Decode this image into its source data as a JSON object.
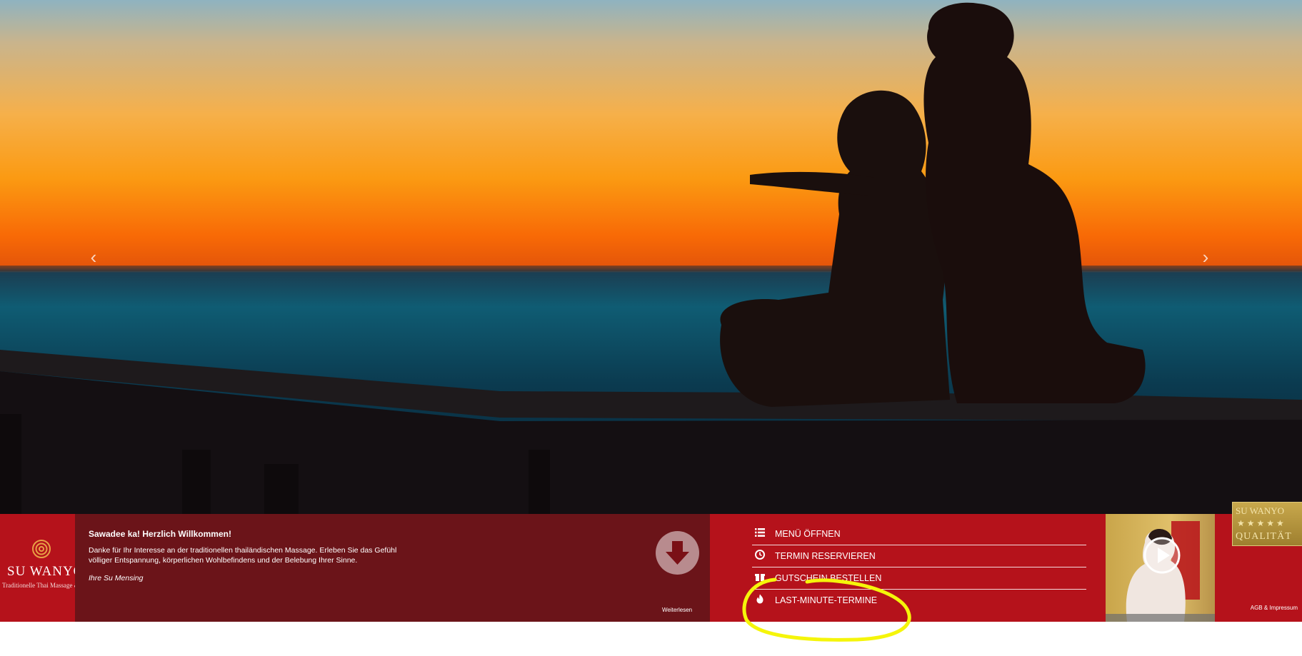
{
  "hero": {
    "prev_icon": "‹",
    "next_icon": "›"
  },
  "logo": {
    "name": "SU WANYO",
    "tagline": "Traditionelle Thai Massage & S"
  },
  "welcome": {
    "title": "Sawadee ka! Herzlich Willkommen!",
    "body": "Danke für Ihr Interesse an der traditionellen thailändischen Massage. Erleben Sie das Gefühl völliger Entspannung, körperlichen Wohlbefindens und der Belebung Ihrer Sinne.",
    "signature": "Ihre Su Mensing",
    "read_more": "Weiterlesen"
  },
  "menu": {
    "items": [
      {
        "label": "MENÜ ÖFFNEN",
        "icon": "list-icon"
      },
      {
        "label": "TERMIN RESERVIEREN",
        "icon": "clock-icon"
      },
      {
        "label": "GUTSCHEIN BESTELLEN",
        "icon": "gift-icon"
      },
      {
        "label": "LAST-MINUTE-TERMINE",
        "icon": "flame-icon"
      }
    ]
  },
  "footer": {
    "legal_link": "AGB & Impressum"
  },
  "badge": {
    "top": "SU WANYO",
    "stars": "★★★★★",
    "bottom": "QUALITÄT"
  },
  "colors": {
    "brand_red": "#b5121b",
    "dark_red": "#6b1419",
    "highlight_yellow": "#f5f50a"
  }
}
